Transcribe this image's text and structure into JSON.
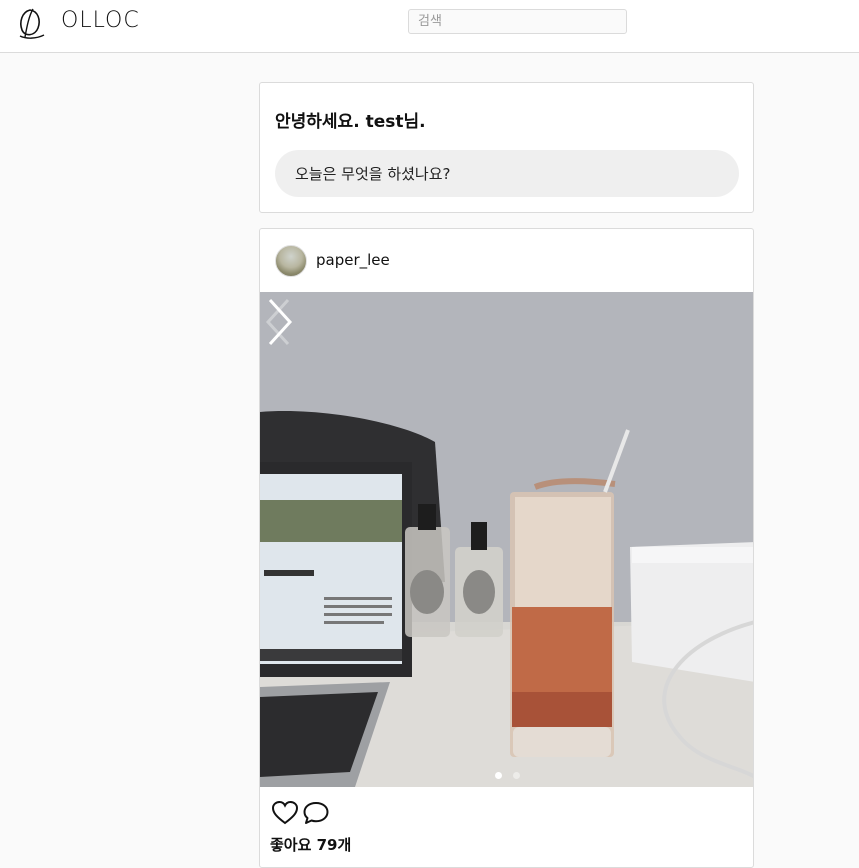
{
  "app": {
    "brand": "OLLOC",
    "logo_icon": "script-o-logo-icon"
  },
  "search": {
    "placeholder": "검색"
  },
  "greeting": {
    "title": "안녕하세요. test님.",
    "prompt_label": "오늘은 무엇을 하셨나요?"
  },
  "post": {
    "username": "paper_lee",
    "photo_description_icon": "post-photo",
    "carousel": {
      "total": 2,
      "active_index": 0
    },
    "icons": {
      "like": "heart-icon",
      "comment": "comment-icon",
      "prev": "chevron-left-icon",
      "next": "chevron-right-icon"
    },
    "likes_label": "좋아요 79개"
  },
  "colors": {
    "background": "#fafafa",
    "border": "#dbdbdb",
    "pill": "#efefef"
  }
}
